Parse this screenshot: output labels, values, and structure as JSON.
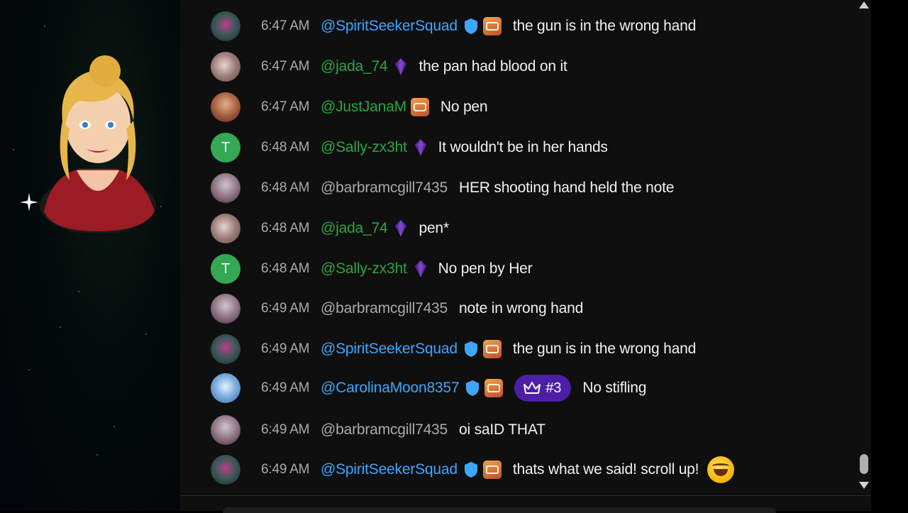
{
  "chat": {
    "messages": [
      {
        "time": "6:47 AM",
        "author": "@SpiritSeekerSquad",
        "text": "the gun is in the wrong hand",
        "avatar": "spirit-avatar",
        "author_color": "blue",
        "verified": true,
        "badge": "member-badge"
      },
      {
        "time": "6:47 AM",
        "author": "@jada_74",
        "text": "the pan had blood on it",
        "avatar": "jada-avatar",
        "author_color": "green",
        "badge": "gem-badge"
      },
      {
        "time": "6:47 AM",
        "author": "@JustJanaM",
        "text": "No pen",
        "avatar": "jana-avatar",
        "author_color": "green",
        "badge": "member-badge"
      },
      {
        "time": "6:48 AM",
        "author": "@Sally-zx3ht",
        "text": "It wouldn't be in her hands",
        "avatar_letter": "T",
        "author_color": "green",
        "badge": "gem-badge"
      },
      {
        "time": "6:48 AM",
        "author": "@barbramcgill7435",
        "text": "HER shooting hand held the note",
        "avatar": "barb-avatar",
        "author_color": "gray"
      },
      {
        "time": "6:48 AM",
        "author": "@jada_74",
        "text": "pen*",
        "avatar": "jada-avatar",
        "author_color": "green",
        "badge": "gem-badge"
      },
      {
        "time": "6:48 AM",
        "author": "@Sally-zx3ht",
        "text": "No pen by Her",
        "avatar_letter": "T",
        "author_color": "green",
        "badge": "gem-badge"
      },
      {
        "time": "6:49 AM",
        "author": "@barbramcgill7435",
        "text": "note in wrong hand",
        "avatar": "barb-avatar",
        "author_color": "gray"
      },
      {
        "time": "6:49 AM",
        "author": "@SpiritSeekerSquad",
        "text": "the gun is in the wrong hand",
        "avatar": "spirit-avatar",
        "author_color": "blue",
        "verified": true,
        "badge": "member-badge"
      },
      {
        "time": "6:49 AM",
        "author": "@CarolinaMoon8357",
        "text": "No stifling",
        "avatar": "carolina-avatar",
        "author_color": "blue",
        "verified": true,
        "badge": "member-badge",
        "rank": "#3"
      },
      {
        "time": "6:49 AM",
        "author": "@barbramcgill7435",
        "text": "oi saID THAT",
        "avatar": "barb-avatar",
        "author_color": "gray"
      },
      {
        "time": "6:49 AM",
        "author": "@SpiritSeekerSquad",
        "text": "thats what we said! scroll up!",
        "avatar": "spirit-avatar",
        "author_color": "blue",
        "verified": true,
        "badge": "member-badge",
        "emoji": "rolling-on-floor-laughing-emoji"
      }
    ]
  },
  "colors": {
    "author_blue": "#3ea6ff",
    "author_green": "#2ba640",
    "rank_pill": "#4c1fa6",
    "chat_bg": "#0f0f0f"
  }
}
